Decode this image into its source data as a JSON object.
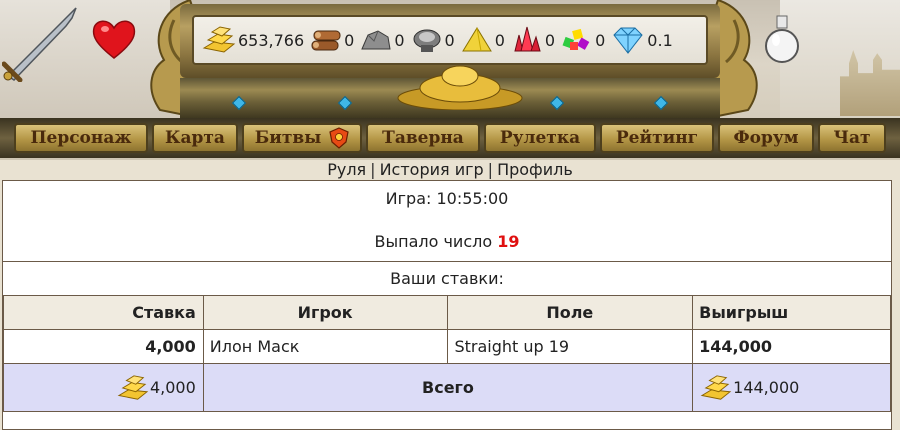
{
  "resources": {
    "gold": "653,766",
    "wood": "0",
    "stone": "0",
    "iron": "0",
    "sulfur": "0",
    "crystals": "0",
    "gems": "0",
    "diamonds": "0.1"
  },
  "icons": [
    "sword-icon",
    "heart-icon",
    "flask-icon",
    "gold-bars-icon",
    "logs-icon",
    "ore-icon",
    "anvil-icon",
    "sulfur-icon",
    "crystal-icon",
    "gems-icon",
    "diamond-icon",
    "shield-icon"
  ],
  "nav": {
    "items": [
      "Персонаж",
      "Карта",
      "Битвы",
      "Таверна",
      "Рулетка",
      "Рейтинг",
      "Форум",
      "Чат"
    ]
  },
  "subnav": {
    "links": [
      "Руля",
      "История игр",
      "Профиль"
    ],
    "separator": "|"
  },
  "game": {
    "time_label": "Игра: 10:55:00",
    "result_label": "Выпало число",
    "result_number": "19",
    "bets_title": "Ваши ставки:"
  },
  "table": {
    "headers": [
      "Ставка",
      "Игрок",
      "Поле",
      "Выигрыш"
    ],
    "rows": [
      {
        "stake": "4,000",
        "player": "Илон Маск",
        "field": "Straight up 19",
        "win": "144,000"
      }
    ],
    "total": {
      "stake": "4,000",
      "label": "Всего",
      "win": "144,000"
    }
  },
  "colors": {
    "result_number": "#e01010",
    "total_row_bg": "#dcdcf7",
    "nav_button": "#b49646"
  }
}
